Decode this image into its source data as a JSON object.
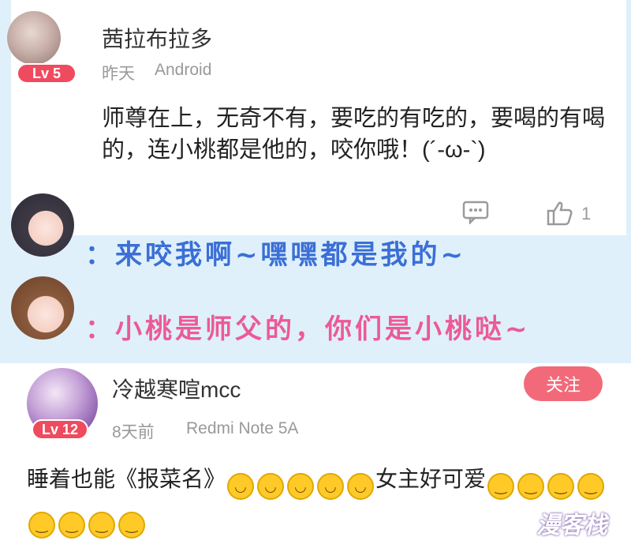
{
  "comment1": {
    "username": "茜拉布拉多",
    "level": "Lv 5",
    "time": "昨天",
    "device": "Android",
    "content": "师尊在上，无奇不有，要吃的有吃的，要喝的有喝的，连小桃都是他的，咬你哦！(´-ω-`)",
    "like_count": "1",
    "comment_icon": "comment-icon",
    "like_icon": "thumbs-up-icon"
  },
  "dialogs": [
    {
      "text": "：来咬我啊~嘿嘿都是我的~",
      "color": "#3b6fd6"
    },
    {
      "text": "：小桃是师父的，你们是小桃哒~",
      "color": "#ec5a95"
    }
  ],
  "comment2": {
    "username": "冷越寒喧mcc",
    "level": "Lv 12",
    "time": "8天前",
    "device": "Redmi Note 5A",
    "follow_label": "关注",
    "content_text_1": "睡着也能《报菜名》",
    "content_text_2": "女主好可爱",
    "grin_count": 5,
    "smile_count": 8
  },
  "watermark": "漫客栈",
  "colors": {
    "accent": "#f26a7a",
    "level_badge": "#f04a5e",
    "background": "#dff0fb"
  }
}
